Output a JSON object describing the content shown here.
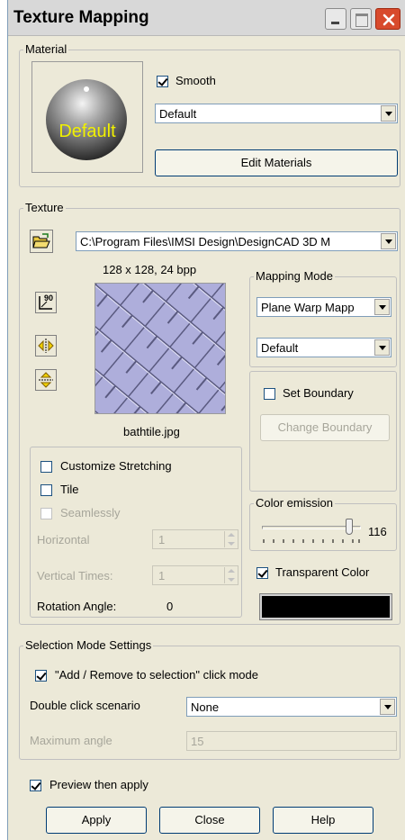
{
  "window": {
    "title": "Texture Mapping"
  },
  "material": {
    "group_label": "Material",
    "preview_label": "Default",
    "smooth_label": "Smooth",
    "smooth_checked": true,
    "material_select": "Default",
    "edit_button": "Edit Materials"
  },
  "texture": {
    "group_label": "Texture",
    "path": "C:\\Program Files\\IMSI Design\\DesignCAD 3D M",
    "info": "128 x 128, 24 bpp",
    "filename": "bathtile.jpg",
    "rotate_label": "90"
  },
  "mapping": {
    "group_label": "Mapping Mode",
    "mode": "Plane Warp Mapp",
    "option": "Default"
  },
  "boundary": {
    "set_label": "Set Boundary",
    "set_checked": false,
    "change_button": "Change Boundary"
  },
  "stretching": {
    "customize_label": "Customize Stretching",
    "tile_label": "Tile",
    "seamless_label": "Seamlessly",
    "horizontal_label": "Horizontal",
    "horizontal_value": "1",
    "vertical_label": "Vertical Times:",
    "vertical_value": "1",
    "rotation_label": "Rotation Angle:",
    "rotation_value": "0"
  },
  "emission": {
    "group_label": "Color emission",
    "value": "116",
    "slider_fraction": 0.91
  },
  "transparent": {
    "label": "Transparent Color",
    "checked": true,
    "swatch_color": "#000000"
  },
  "selection": {
    "group_label": "Selection Mode Settings",
    "click_mode_label": "\"Add / Remove to selection\" click mode",
    "click_mode_checked": true,
    "double_click_label": "Double click scenario",
    "double_click_value": "None",
    "max_angle_label": "Maximum angle",
    "max_angle_value": "15"
  },
  "footer": {
    "preview_label": "Preview then apply",
    "preview_checked": true,
    "apply_button": "Apply",
    "close_button": "Close",
    "help_button": "Help"
  }
}
